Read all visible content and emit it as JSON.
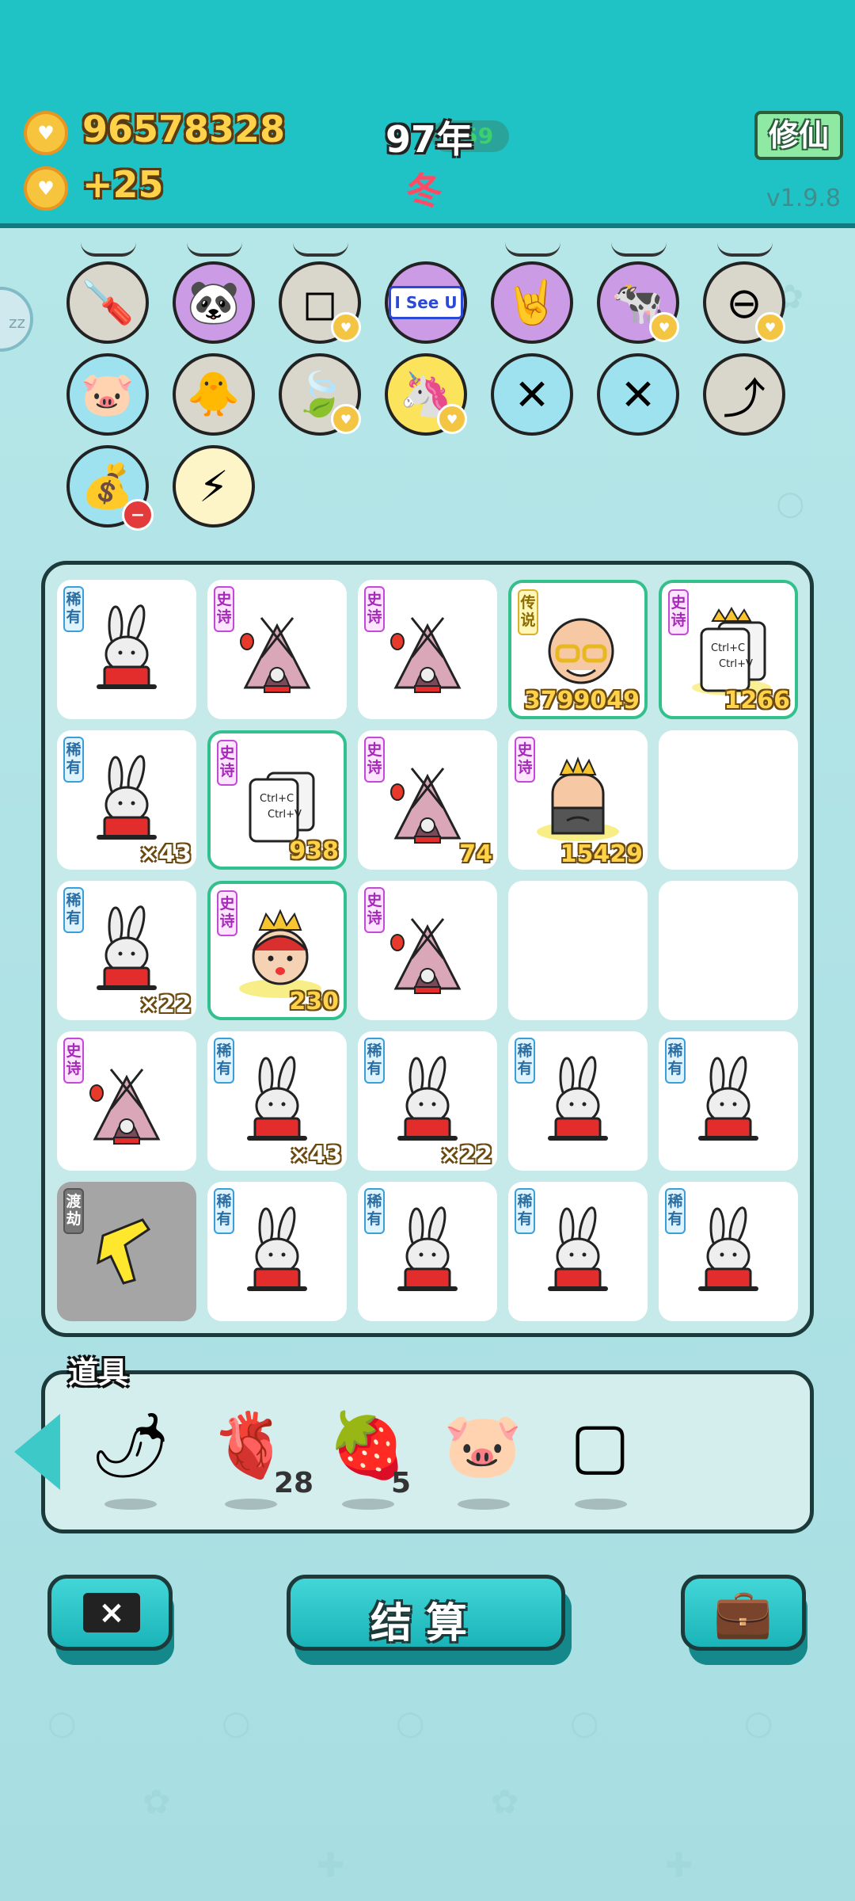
{
  "header": {
    "gold_total": "96578328",
    "gold_income": "+25",
    "year": "97年",
    "year_overlay": "559",
    "season": "冬",
    "cultivate_button": "修仙",
    "version": "v1.9.8"
  },
  "edge_badge": "zz",
  "relics": [
    {
      "name": "screwdriver",
      "icon": "🪛",
      "bg": "grey"
    },
    {
      "name": "panda",
      "icon": "🐼",
      "bg": "purple"
    },
    {
      "name": "sugar-cubes",
      "icon": "◻",
      "bg": "grey"
    },
    {
      "name": "i-see-u",
      "label": "I See U",
      "bg": "purple"
    },
    {
      "name": "rock-hand",
      "icon": "🤘",
      "bg": "purple"
    },
    {
      "name": "cow-pair",
      "icon": "🐄",
      "bg": "purple"
    },
    {
      "name": "no-entry",
      "icon": "⊖",
      "bg": "grey"
    },
    {
      "name": "piggy-bank",
      "icon": "🐷",
      "bg": "blue"
    },
    {
      "name": "chick-egg",
      "icon": "🐥",
      "bg": "grey"
    },
    {
      "name": "leaf",
      "icon": "🍃",
      "bg": "grey"
    },
    {
      "name": "unicorn",
      "icon": "🦄",
      "bg": "yellow"
    },
    {
      "name": "crossed-sticks-1",
      "icon": "✕",
      "bg": "blue"
    },
    {
      "name": "crossed-sticks-2",
      "icon": "✕",
      "bg": "blue"
    },
    {
      "name": "arrow-card",
      "icon": "⤴",
      "bg": "grey"
    },
    {
      "name": "money-bag",
      "icon": "💰",
      "bg": "blue"
    },
    {
      "name": "lightning",
      "icon": "⚡",
      "bg": "cream"
    }
  ],
  "tags": {
    "rare": "稀有",
    "epic": "史诗",
    "legend": "传说",
    "tribulation": "渡劫"
  },
  "ctrl_text": "Ctrl+C\nCtrl+V",
  "board": [
    [
      {
        "tag": "rare",
        "item": "rabbit"
      },
      {
        "tag": "epic",
        "item": "tent"
      },
      {
        "tag": "epic",
        "item": "tent"
      },
      {
        "tag": "legend",
        "item": "bald-man",
        "count": "3799049",
        "hl": true
      },
      {
        "tag": "epic",
        "item": "ctrl-crown",
        "count": "1266",
        "hl": true
      }
    ],
    [
      {
        "tag": "rare",
        "item": "rabbit",
        "count": "×43"
      },
      {
        "tag": "epic",
        "item": "ctrl",
        "count": "938",
        "hl": true
      },
      {
        "tag": "epic",
        "item": "tent",
        "count": "74"
      },
      {
        "tag": "epic",
        "item": "king",
        "count": "15429"
      },
      {
        "item": "empty"
      }
    ],
    [
      {
        "tag": "rare",
        "item": "rabbit",
        "count": "×22"
      },
      {
        "tag": "epic",
        "item": "boy-king",
        "count": "230",
        "hl": true
      },
      {
        "tag": "epic",
        "item": "tent"
      },
      {
        "item": "empty"
      },
      {
        "item": "empty"
      }
    ],
    [
      {
        "tag": "epic",
        "item": "tent"
      },
      {
        "tag": "rare",
        "item": "rabbit",
        "count": "×43"
      },
      {
        "tag": "rare",
        "item": "rabbit",
        "count": "×22"
      },
      {
        "tag": "rare",
        "item": "rabbit"
      },
      {
        "tag": "rare",
        "item": "rabbit"
      }
    ],
    [
      {
        "tag": "tribulation",
        "item": "pointing-hand",
        "grey": true
      },
      {
        "tag": "rare",
        "item": "rabbit"
      },
      {
        "tag": "rare",
        "item": "rabbit"
      },
      {
        "tag": "rare",
        "item": "rabbit"
      },
      {
        "tag": "rare",
        "item": "rabbit"
      }
    ]
  ],
  "props": {
    "title": "道具",
    "items": [
      {
        "name": "chili-pepper",
        "icon": "🌶",
        "count": ""
      },
      {
        "name": "liver",
        "icon": "🫀",
        "count": "28"
      },
      {
        "name": "strawberry",
        "icon": "🍓",
        "count": "5"
      },
      {
        "name": "piggy-bank",
        "icon": "🐷",
        "count": ""
      },
      {
        "name": "blank-frame",
        "icon": "▢",
        "count": ""
      }
    ]
  },
  "buttons": {
    "close_icon": "×",
    "settle": "结算",
    "briefcase_icon": "💼"
  },
  "colors": {
    "header_bg": "#1fc3c6",
    "highlight_border": "#34c08d",
    "gold": "#ffd24a",
    "season": "#ff4a66"
  }
}
